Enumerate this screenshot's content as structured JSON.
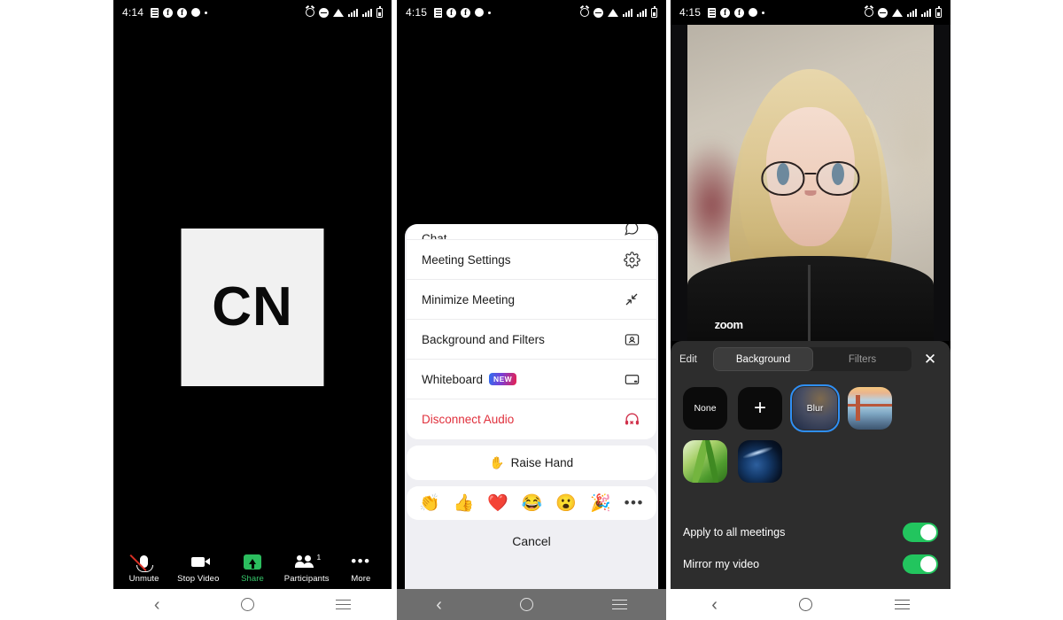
{
  "panels": {
    "panel1": {
      "status": {
        "time": "4:14"
      },
      "avatar": {
        "initials": "CN"
      },
      "toolbar": [
        {
          "label": "Unmute",
          "icon": "microphone-muted-icon",
          "state": "muted"
        },
        {
          "label": "Stop Video",
          "icon": "video-camera-icon",
          "state": "on"
        },
        {
          "label": "Share",
          "icon": "share-screen-icon",
          "state": "active"
        },
        {
          "label": "Participants",
          "icon": "participants-icon",
          "count": "1"
        },
        {
          "label": "More",
          "icon": "more-dots-icon",
          "state": "open"
        }
      ]
    },
    "panel2": {
      "status": {
        "time": "4:15"
      },
      "menu": [
        {
          "label": "Chat",
          "icon": "chat-bubble-icon",
          "partial": true
        },
        {
          "label": "Meeting Settings",
          "icon": "gear-icon"
        },
        {
          "label": "Minimize Meeting",
          "icon": "minimize-arrows-icon"
        },
        {
          "label": "Background and Filters",
          "icon": "person-frame-icon"
        },
        {
          "label": "Whiteboard",
          "icon": "whiteboard-icon",
          "badge": "NEW"
        },
        {
          "label": "Disconnect Audio",
          "icon": "headset-off-icon",
          "danger": true
        }
      ],
      "raise_hand": {
        "label": "Raise Hand",
        "emoji": "✋"
      },
      "reactions": [
        {
          "name": "clap-reaction",
          "emoji": "👏"
        },
        {
          "name": "thumbs-up-reaction",
          "emoji": "👍"
        },
        {
          "name": "heart-reaction",
          "emoji": "❤️"
        },
        {
          "name": "joy-reaction",
          "emoji": "😂"
        },
        {
          "name": "open-mouth-reaction",
          "emoji": "😮"
        },
        {
          "name": "party-popper-reaction",
          "emoji": "🎉"
        }
      ],
      "reactions_more": "•••",
      "cancel": {
        "label": "Cancel"
      }
    },
    "panel3": {
      "status": {
        "time": "4:15"
      },
      "video": {
        "person_label": "zoom"
      },
      "tabs": {
        "edit_label": "Edit",
        "items": [
          {
            "label": "Background",
            "active": true
          },
          {
            "label": "Filters",
            "active": false
          }
        ],
        "close_icon": "close-icon"
      },
      "backgrounds": [
        {
          "label": "None",
          "type": "none",
          "selected": false
        },
        {
          "label": "+",
          "type": "add",
          "selected": false
        },
        {
          "label": "Blur",
          "type": "blur",
          "selected": true
        },
        {
          "label": "",
          "type": "bridge",
          "selected": false
        },
        {
          "label": "",
          "type": "grass",
          "selected": false
        },
        {
          "label": "",
          "type": "earth",
          "selected": false
        }
      ],
      "settings": [
        {
          "label": "Apply to all meetings",
          "value": "on"
        },
        {
          "label": "Mirror my video",
          "value": "on"
        }
      ]
    }
  },
  "colors": {
    "zoom_green": "#2bbd5e",
    "toggle_green": "#22c55e",
    "danger_red": "#e0303c",
    "accent_blue": "#2f8ff5"
  }
}
